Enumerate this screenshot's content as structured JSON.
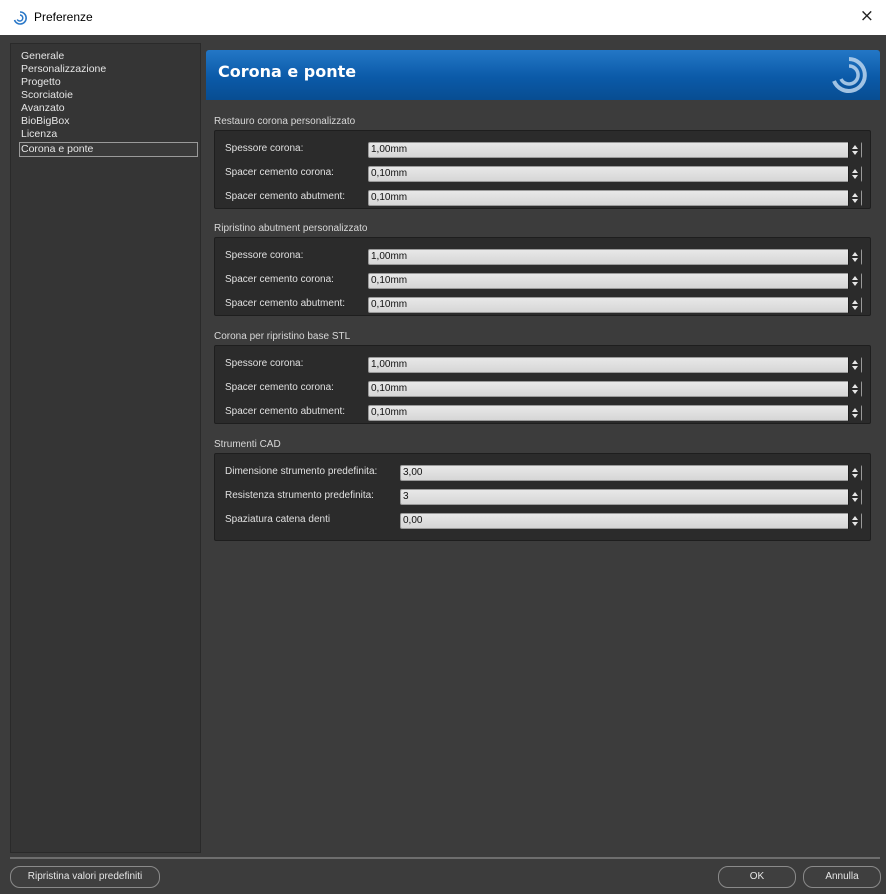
{
  "window": {
    "title": "Preferenze",
    "close_symbol": "×",
    "icon": "swirl-logo-icon"
  },
  "sidebar": {
    "items": [
      {
        "label": "Generale",
        "selected": false
      },
      {
        "label": "Personalizzazione",
        "selected": false
      },
      {
        "label": "Progetto",
        "selected": false
      },
      {
        "label": "Scorciatoie",
        "selected": false
      },
      {
        "label": "Avanzato",
        "selected": false
      },
      {
        "label": "BioBigBox",
        "selected": false
      },
      {
        "label": "Licenza",
        "selected": false
      },
      {
        "label": "Corona e ponte",
        "selected": true
      }
    ]
  },
  "main": {
    "title": "Corona e ponte",
    "accent_color": "#0b5aa8",
    "groups": [
      {
        "title": "Restauro corona personalizzato",
        "fields": [
          {
            "label": "Spessore corona:",
            "value": "1,00mm"
          },
          {
            "label": "Spacer cemento corona:",
            "value": "0,10mm"
          },
          {
            "label": "Spacer cemento abutment:",
            "value": "0,10mm"
          }
        ]
      },
      {
        "title": "Ripristino abutment personalizzato",
        "fields": [
          {
            "label": "Spessore corona:",
            "value": "1,00mm"
          },
          {
            "label": "Spacer cemento corona:",
            "value": "0,10mm"
          },
          {
            "label": "Spacer cemento abutment:",
            "value": "0,10mm"
          }
        ]
      },
      {
        "title": "Corona per ripristino base STL",
        "fields": [
          {
            "label": "Spessore corona:",
            "value": "1,00mm"
          },
          {
            "label": "Spacer cemento corona:",
            "value": "0,10mm"
          },
          {
            "label": "Spacer cemento abutment:",
            "value": "0,10mm"
          }
        ]
      },
      {
        "title": "Strumenti CAD",
        "fields": [
          {
            "label": "Dimensione strumento predefinita:",
            "value": "3,00"
          },
          {
            "label": "Resistenza strumento predefinita:",
            "value": "3"
          },
          {
            "label": "Spaziatura catena denti",
            "value": "0,00"
          }
        ]
      }
    ]
  },
  "footer": {
    "restore_label": "Ripristina valori predefiniti",
    "ok_label": "OK",
    "cancel_label": "Annulla"
  }
}
